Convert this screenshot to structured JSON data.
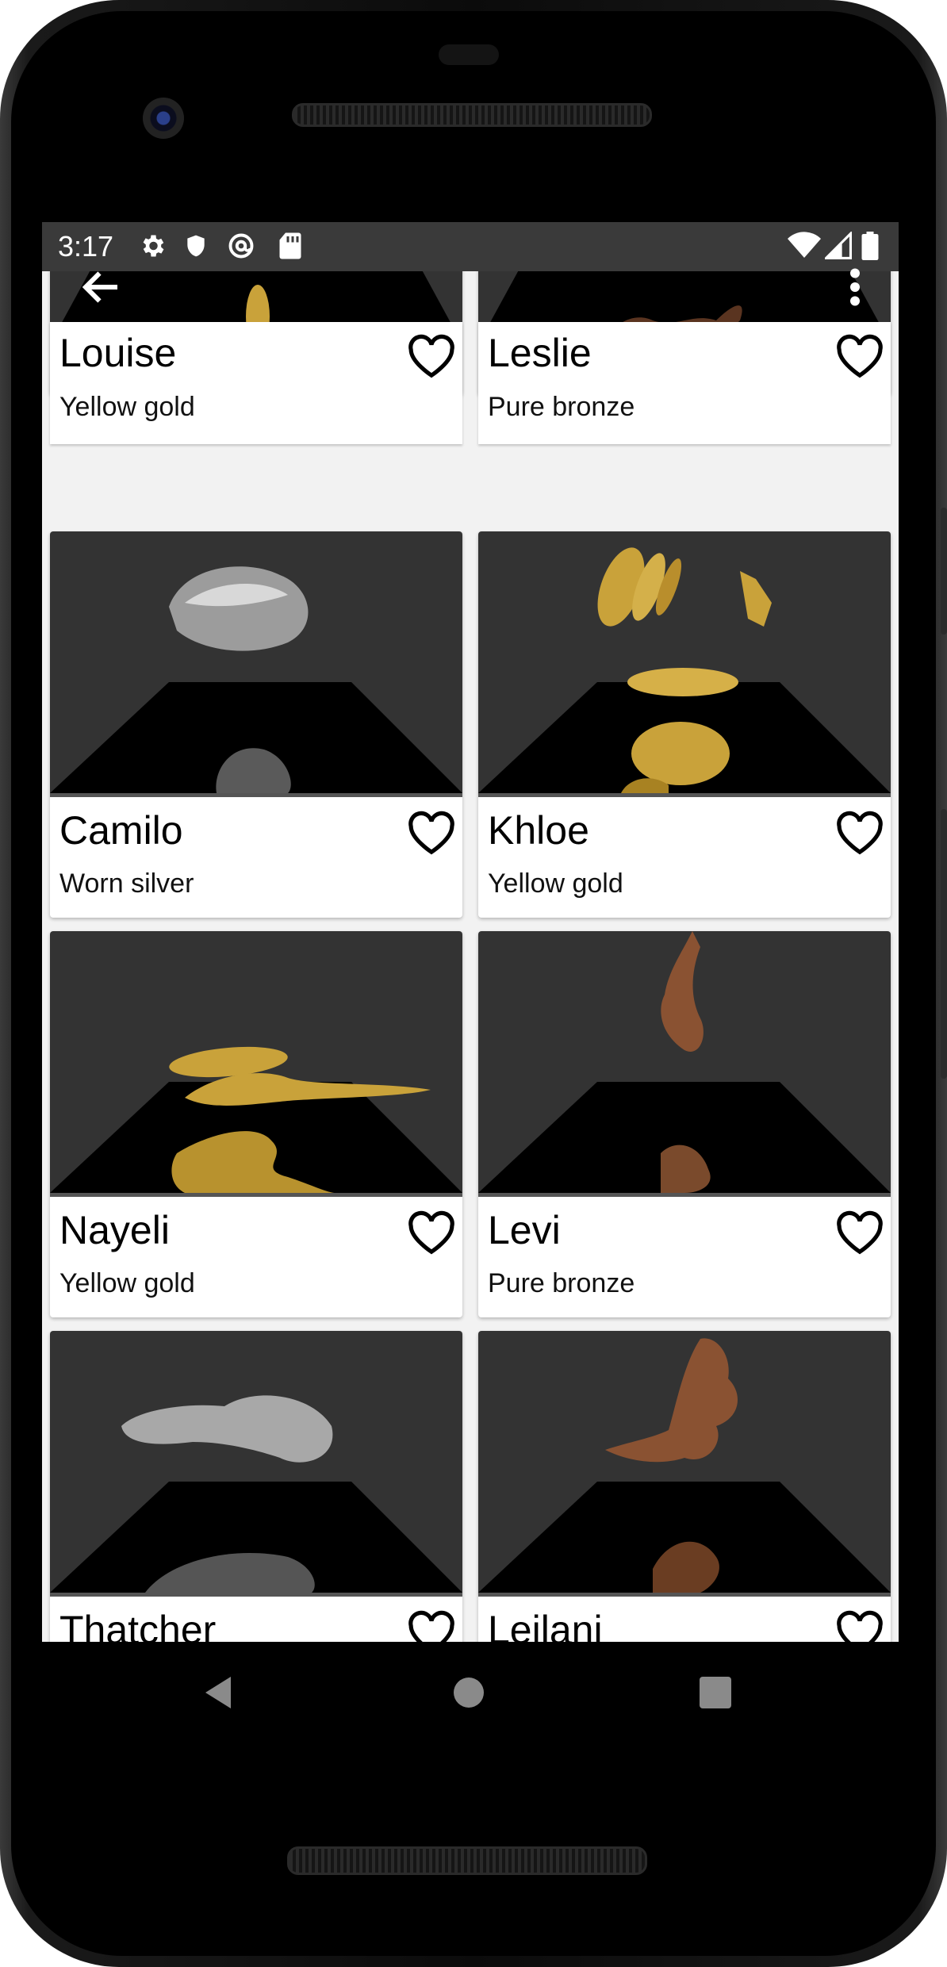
{
  "status_bar": {
    "time": "3:17",
    "icons": [
      "gear-icon",
      "shield-icon",
      "at-sign-icon",
      "sd-card-icon",
      "wifi-icon",
      "signal-icon",
      "battery-icon"
    ]
  },
  "app_bar": {
    "back_icon": "arrow-left-icon",
    "menu_icon": "more-vertical-icon"
  },
  "items": [
    {
      "name": "Louise",
      "material": "Yellow gold"
    },
    {
      "name": "Leslie",
      "material": "Pure bronze"
    },
    {
      "name": "Camilo",
      "material": "Worn silver"
    },
    {
      "name": "Khloe",
      "material": "Yellow gold"
    },
    {
      "name": "Nayeli",
      "material": "Yellow gold"
    },
    {
      "name": "Levi",
      "material": "Pure bronze"
    },
    {
      "name": "Thatcher",
      "material": ""
    },
    {
      "name": "Leilani",
      "material": ""
    }
  ],
  "colors": {
    "gold": "#c9a23a",
    "bronze": "#8a5232",
    "silver": "#b8b8b8",
    "thumb_bg": "#333333",
    "status_bar": "#3a3a3a"
  },
  "nav_bar": {
    "back": "triangle-back-icon",
    "home": "circle-home-icon",
    "recents": "square-recents-icon"
  }
}
